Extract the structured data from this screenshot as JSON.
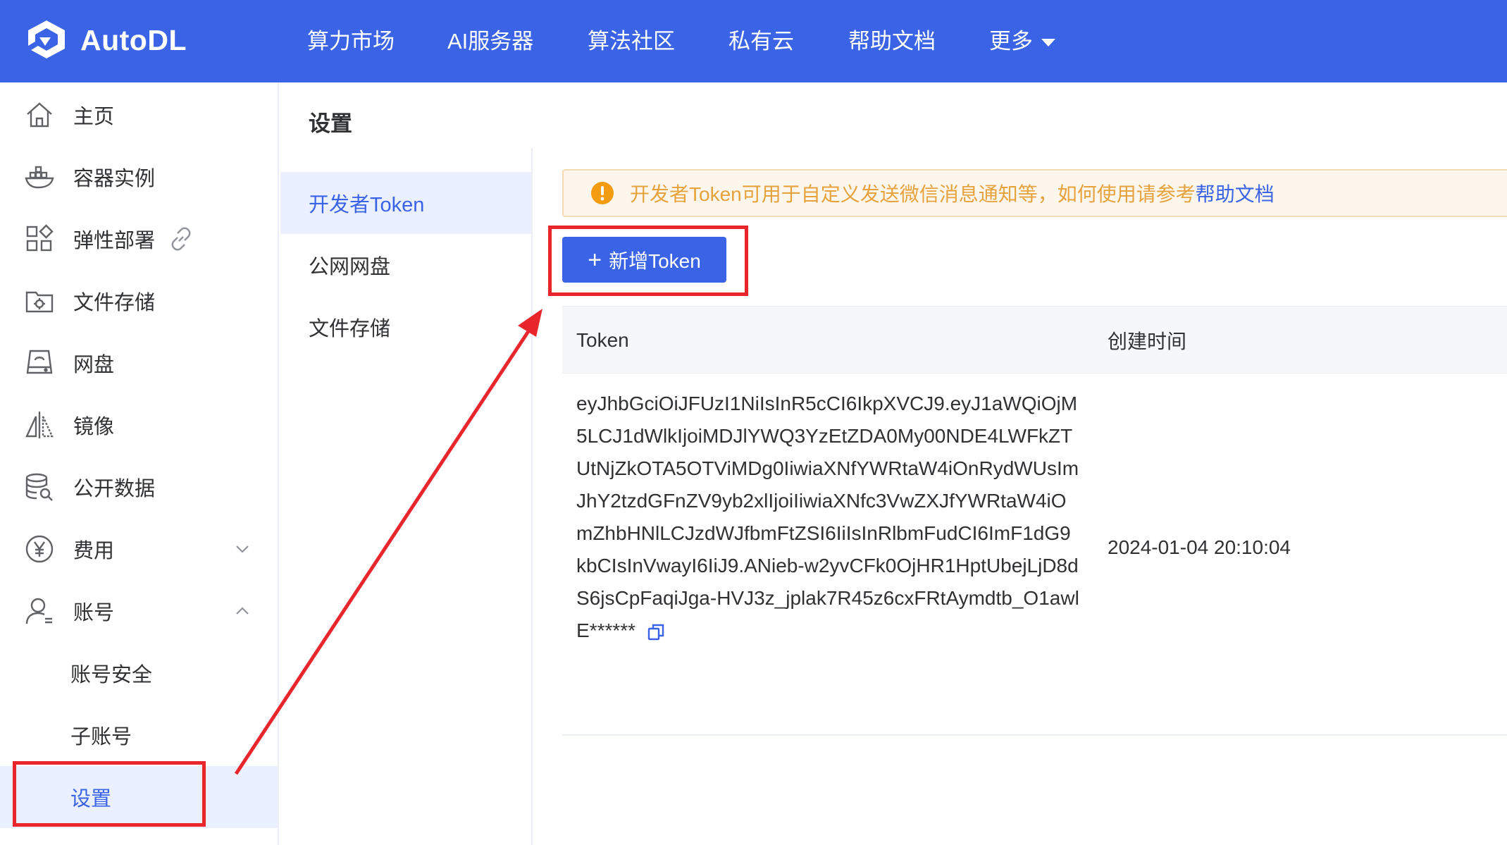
{
  "colors": {
    "brand": "#3a63e6",
    "active_bg": "#eaf0ff",
    "warning": "#e6a23c",
    "warning_bg": "#fdf6ec",
    "annotation_red": "#e8262c"
  },
  "header": {
    "logo_text": "AutoDL",
    "nav": [
      {
        "label": "算力市场"
      },
      {
        "label": "AI服务器"
      },
      {
        "label": "算法社区"
      },
      {
        "label": "私有云"
      },
      {
        "label": "帮助文档"
      },
      {
        "label": "更多",
        "icon": "caret-down-icon"
      }
    ]
  },
  "sidebar": {
    "items": [
      {
        "label": "主页",
        "icon": "home-icon"
      },
      {
        "label": "容器实例",
        "icon": "container-ship-icon"
      },
      {
        "label": "弹性部署",
        "icon": "grid-icon",
        "extra_icon": "link-icon"
      },
      {
        "label": "文件存储",
        "icon": "folder-gear-icon"
      },
      {
        "label": "网盘",
        "icon": "disk-icon"
      },
      {
        "label": "镜像",
        "icon": "mirror-icon"
      },
      {
        "label": "公开数据",
        "icon": "database-icon"
      },
      {
        "label": "费用",
        "icon": "yen-icon",
        "chevron": "chevron-down-icon"
      },
      {
        "label": "账号",
        "icon": "user-icon",
        "chevron": "chevron-up-icon"
      },
      {
        "label": "账号安全"
      },
      {
        "label": "子账号"
      },
      {
        "label": "设置",
        "active": true
      }
    ]
  },
  "main": {
    "title": "设置",
    "subnav": [
      {
        "label": "开发者Token",
        "active": true
      },
      {
        "label": "公网网盘"
      },
      {
        "label": "文件存储"
      }
    ],
    "alert": {
      "text": "开发者Token可用于自定义发送微信消息通知等，如何使用请参考",
      "link": "帮助文档"
    },
    "add_button": {
      "plus": "+",
      "label": "新增Token"
    },
    "table": {
      "columns": [
        "Token",
        "创建时间"
      ],
      "rows": [
        {
          "token_lines": [
            "eyJhbGciOiJFUzI1NiIsInR5cCI6IkpXVCJ9.eyJ1aWQiOjM",
            "5LCJ1dWlkIjoiMDJlYWQ3YzEtZDA0My00NDE4LWFkZT",
            "UtNjZkOTA5OTViMDg0IiwiaXNfYWRtaW4iOnRydWUsIm",
            "JhY2tzdGFnZV9yb2xlIjoiIiwiaXNfc3VwZXJfYWRtaW4iO",
            "mZhbHNlLCJzdWJfbmFtZSI6IiIsInRlbmFudCI6ImF1dG9",
            "kbCIsInVwayI6IiJ9.ANieb-w2yvCFk0OjHR1HptUbejLjD8d",
            "S6jsCpFaqiJga-HVJ3z_jplak7R45z6cxFRtAymdtb_O1awl",
            "E******"
          ],
          "created_at": "2024-01-04 20:10:04"
        }
      ]
    }
  }
}
